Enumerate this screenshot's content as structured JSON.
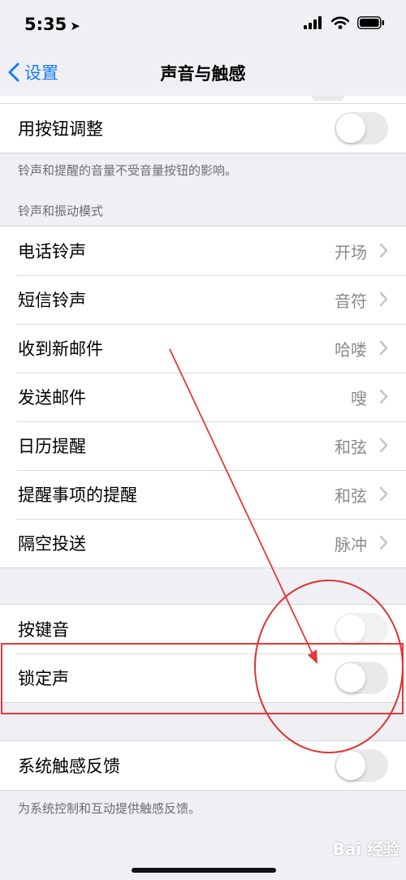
{
  "status": {
    "time": "5:35",
    "location_glyph": "➤"
  },
  "nav": {
    "back_label": "设置",
    "title": "声音与触感"
  },
  "group1": {
    "row_label": "用按钮调整",
    "note": "铃声和提醒的音量不受音量按钮的影响。"
  },
  "section_header": "铃声和振动模式",
  "sounds": [
    {
      "label": "电话铃声",
      "value": "开场"
    },
    {
      "label": "短信铃声",
      "value": "音符"
    },
    {
      "label": "收到新邮件",
      "value": "哈喽"
    },
    {
      "label": "发送邮件",
      "value": "嗖"
    },
    {
      "label": "日历提醒",
      "value": "和弦"
    },
    {
      "label": "提醒事项的提醒",
      "value": "和弦"
    },
    {
      "label": "隔空投送",
      "value": "脉冲"
    }
  ],
  "group3": {
    "keyboard_clicks": "按键音",
    "lock_sound": "锁定声"
  },
  "group4": {
    "haptics_label": "系统触感反馈",
    "note": "为系统控制和互动提供触感反馈。"
  },
  "watermark": "Bai 经验",
  "colors": {
    "accent": "#1a7cf5",
    "annotation": "#e23a3a",
    "background": "#efeff4"
  }
}
